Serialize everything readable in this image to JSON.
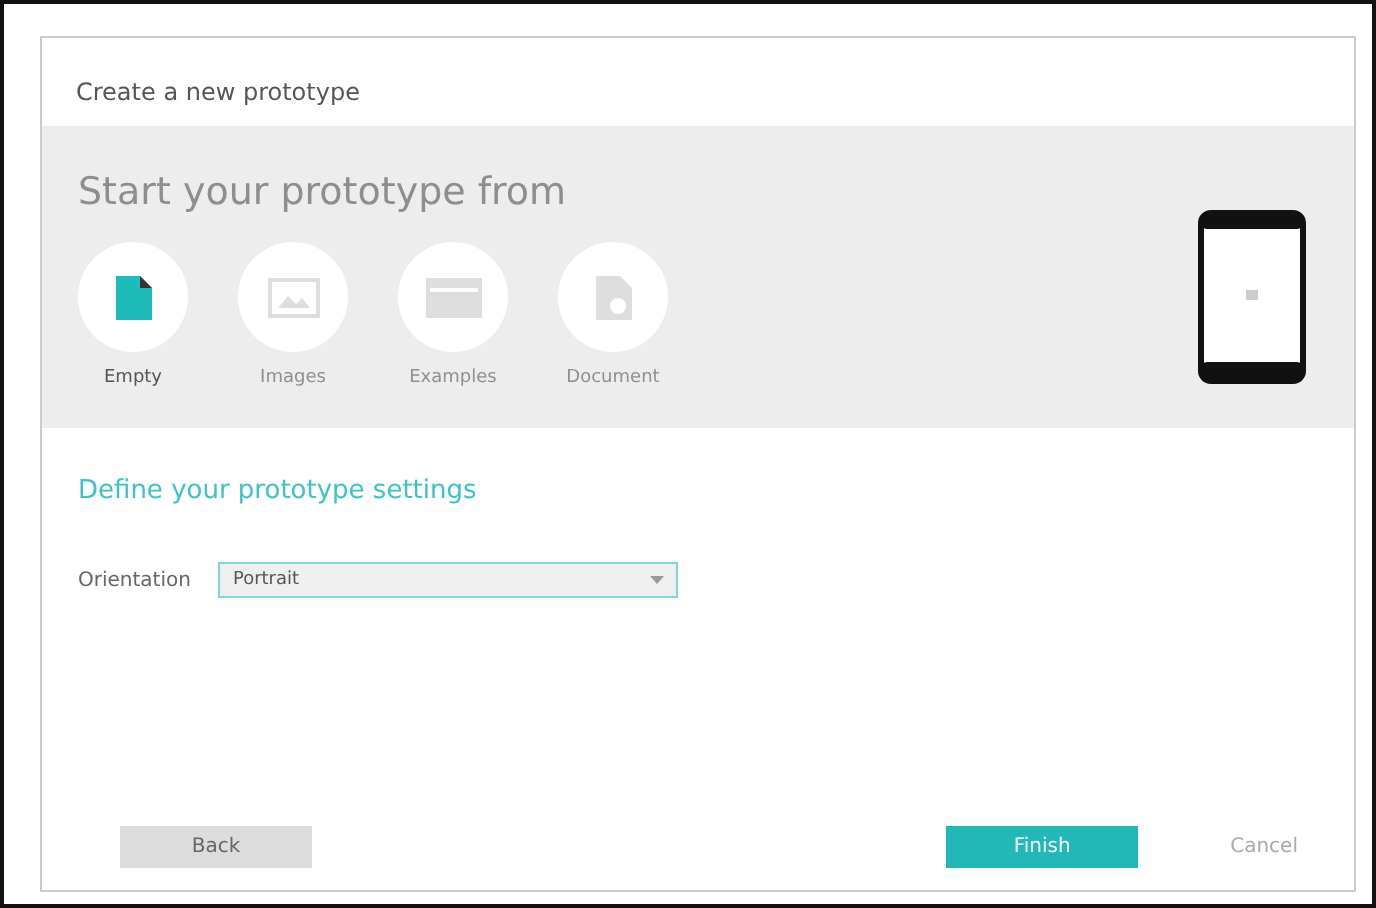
{
  "dialog": {
    "title": "Create a new prototype"
  },
  "start": {
    "heading": "Start your prototype from",
    "options": [
      {
        "kind": "empty",
        "label": "Empty",
        "selected": true
      },
      {
        "kind": "images",
        "label": "Images",
        "selected": false
      },
      {
        "kind": "examples",
        "label": "Examples",
        "selected": false
      },
      {
        "kind": "document",
        "label": "Document",
        "selected": false
      }
    ]
  },
  "settings": {
    "heading": "Define your prototype settings",
    "fields": [
      {
        "label": "Orientation",
        "value": "Portrait"
      }
    ]
  },
  "buttons": [
    {
      "kind": "back",
      "label": "Back"
    },
    {
      "kind": "finish",
      "label": "Finish"
    },
    {
      "kind": "cancel",
      "label": "Cancel"
    }
  ]
}
